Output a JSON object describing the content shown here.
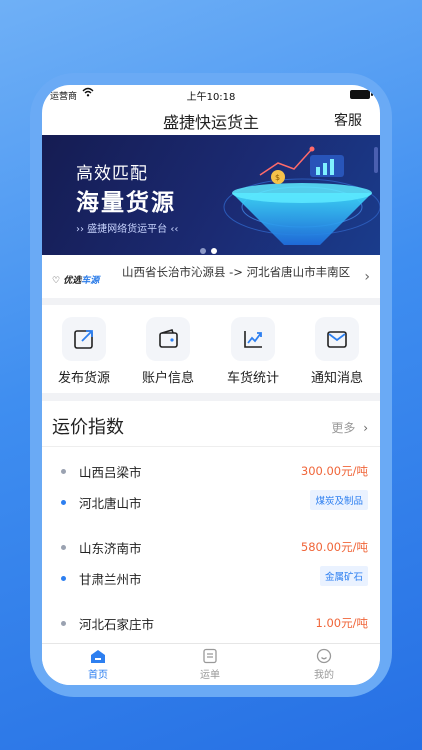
{
  "status_bar": {
    "carrier": "运营商",
    "time": "上午10:18"
  },
  "nav": {
    "title": "盛捷快运货主",
    "service": "客服"
  },
  "banner": {
    "line1": "高效匹配",
    "line2": "海量货源",
    "tagline": "›› 盛捷网络货运平台 ‹‹"
  },
  "route": {
    "badge_text": "优选",
    "badge_accent": "车源",
    "text": "山西省长治市沁源县 -> 河北省唐山市丰南区"
  },
  "menu": [
    {
      "label": "发布货源",
      "icon": "publish-icon"
    },
    {
      "label": "账户信息",
      "icon": "wallet-icon"
    },
    {
      "label": "车货统计",
      "icon": "chart-icon"
    },
    {
      "label": "通知消息",
      "icon": "mail-icon"
    }
  ],
  "rates": {
    "title": "运价指数",
    "more": "更多",
    "items": [
      {
        "from": "山西吕梁市",
        "to": "河北唐山市",
        "price": "300.00元/吨",
        "tag": "煤炭及制品"
      },
      {
        "from": "山东济南市",
        "to": "甘肃兰州市",
        "price": "580.00元/吨",
        "tag": "金属矿石"
      },
      {
        "from": "河北石家庄市",
        "price": "1.00元/吨"
      }
    ]
  },
  "tabs": [
    {
      "label": "首页",
      "icon": "home-icon",
      "active": true
    },
    {
      "label": "运单",
      "icon": "waybill-icon",
      "active": false
    },
    {
      "label": "我的",
      "icon": "profile-icon",
      "active": false
    }
  ],
  "colors": {
    "primary": "#2d7ff0",
    "price": "#f0663a",
    "banner_dark": "#151c52"
  }
}
